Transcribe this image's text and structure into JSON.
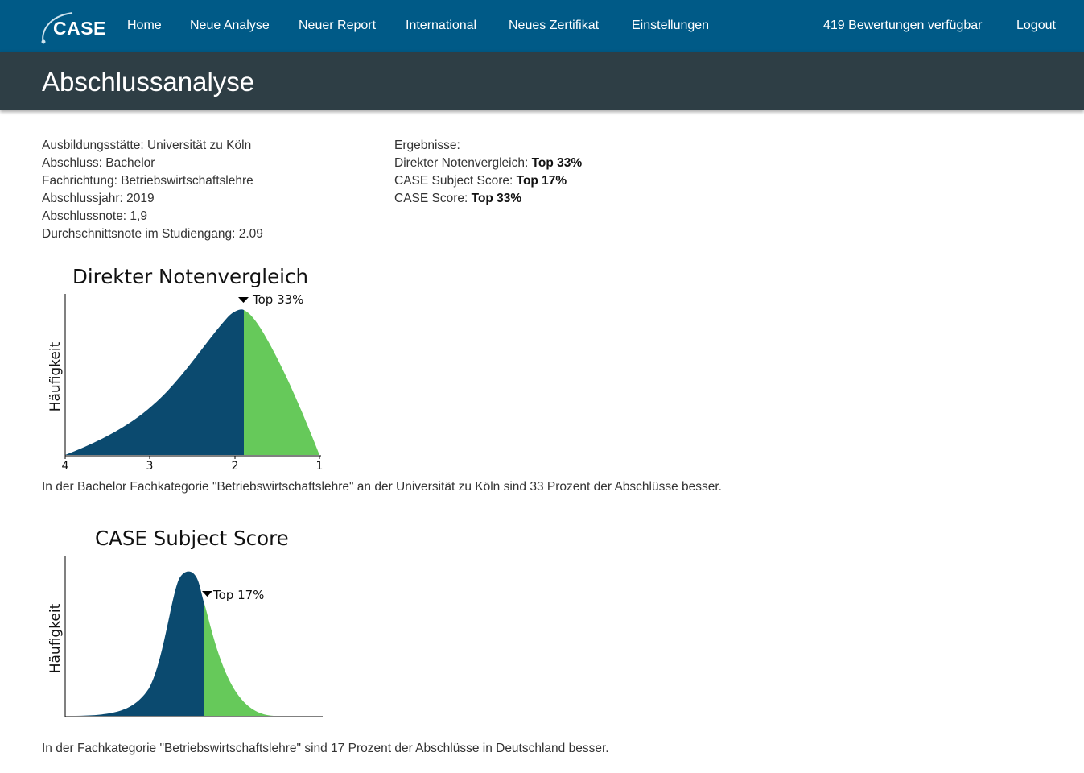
{
  "nav": {
    "logo": "CASE",
    "items": [
      "Home",
      "Neue Analyse",
      "Neuer Report",
      "International",
      "Neues Zertifikat",
      "Einstellungen"
    ],
    "credits": "419 Bewertungen verfügbar",
    "logout": "Logout"
  },
  "page": {
    "title": "Abschlussanalyse"
  },
  "details": [
    "Ausbildungsstätte: Universität zu Köln",
    "Abschluss: Bachelor",
    "Fachrichtung: Betriebswirtschaftslehre",
    "Abschlussjahr: 2019",
    "Abschlussnote: 1,9",
    "Durchschnittsnote im Studiengang: 2.09"
  ],
  "results": {
    "heading": "Ergebnisse:",
    "items": [
      {
        "label": "Direkter Notenvergleich: ",
        "value": "Top 33%"
      },
      {
        "label": "CASE Subject Score: ",
        "value": "Top 17%"
      },
      {
        "label": "CASE Score: ",
        "value": "Top 33%"
      }
    ]
  },
  "colors": {
    "nav": "#005a87",
    "titlebar": "#2e3e45",
    "below": "#0b4a6f",
    "better": "#66c95a"
  },
  "chart_data": [
    {
      "type": "area",
      "title": "Direkter Notenvergleich",
      "ylabel": "Häufigkeit",
      "xlabel": "",
      "x_ticks": [
        4,
        3,
        2,
        1
      ],
      "xlim": [
        4,
        1
      ],
      "marker_x": 1.9,
      "marker_label": "Top 33%",
      "caption": "In der Bachelor Fachkategorie \"Betriebswirtschaftslehre\" an der Universität zu Köln sind 33 Prozent der Abschlüsse besser."
    },
    {
      "type": "area",
      "title": "CASE Subject Score",
      "ylabel": "Häufigkeit",
      "xlabel": "",
      "x_ticks": [],
      "marker_label": "Top 17%",
      "caption": "In der Fachkategorie \"Betriebswirtschaftslehre\" sind 17 Prozent der Abschlüsse in Deutschland besser."
    }
  ]
}
